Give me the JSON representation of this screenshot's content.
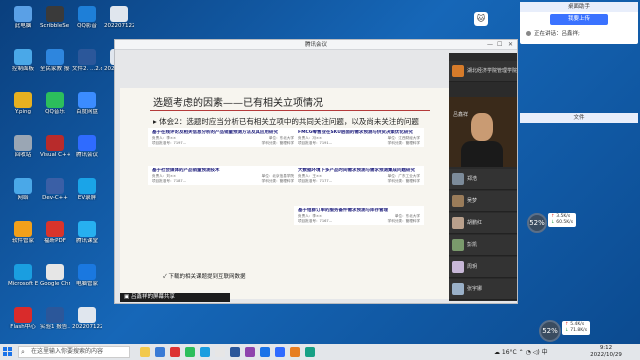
{
  "desktop": {
    "icons": [
      {
        "label": "此电脑",
        "color": "#5aa0e6"
      },
      {
        "label": "ScribbleSe\ndekl-4d...",
        "color": "#3a3a3a"
      },
      {
        "label": "QQ影音",
        "color": "#1e7fd8"
      },
      {
        "label": "2022071220001247...",
        "color": "#e0e6ee"
      },
      {
        "label": "控制面板",
        "color": "#4aa8e8"
      },
      {
        "label": "全民家教\n报名链",
        "color": "#2e86de"
      },
      {
        "label": "文件2.\n...2.docx",
        "color": "#2b579a"
      },
      {
        "label": "2022071220001247...",
        "color": "#e0e6ee"
      },
      {
        "label": "Y.ping",
        "color": "#e6b020"
      },
      {
        "label": "QQ音乐",
        "color": "#2cbe5c"
      },
      {
        "label": "百度网盘",
        "color": "#3b8cff"
      },
      {
        "label": "回收站",
        "color": "#9aa6b4"
      },
      {
        "label": "Visual C++\n6.0",
        "color": "#b82b2b"
      },
      {
        "label": "腾讯会议",
        "color": "#2f6bff"
      },
      {
        "label": "网络",
        "color": "#4aa8e8"
      },
      {
        "label": "Dev-C++",
        "color": "#3a5fa6"
      },
      {
        "label": "EV录屏",
        "color": "#1aa4e8"
      },
      {
        "label": "软件管家",
        "color": "#f2a01a"
      },
      {
        "label": "福昕PDF",
        "color": "#d9342b"
      },
      {
        "label": "腾讯课堂",
        "color": "#27b0f0"
      },
      {
        "label": "Microsoft\nEdge",
        "color": "#1a9ee0"
      },
      {
        "label": "Google\nChrome",
        "color": "#e6e6e6"
      },
      {
        "label": "电脑管家",
        "color": "#1a78e0"
      },
      {
        "label": "Flash中心",
        "color": "#d92b2b"
      },
      {
        "label": "实验1 报告...",
        "color": "#2b579a"
      },
      {
        "label": "2022071220001247...",
        "color": "#e0e6ee"
      }
    ]
  },
  "helper_panel": {
    "title": "桌面助手",
    "button_label": "我要上传",
    "speaking_text": "正在讲话：吕鑫祥;",
    "doc_title": "文件"
  },
  "meeting": {
    "window_title": "腾讯会议",
    "share_label": "吕鑫祥的屏幕共享",
    "slide": {
      "title": "选题考虑的因素——已有相关立项情况",
      "body": "体会2：选题时应当分析已有相关立项中的共同关注问题，以及尚未关注的问题（创新点）",
      "bullet": "▸",
      "note": "下载的相关课题提到互联网数据",
      "note_icon": "✓",
      "refs": [
        {
          "title": "基于在线评论及相关信息分析的产品销量预测方法及其应用研究",
          "meta": [
            "负责人：李××",
            "单位：东北大学",
            "项目批准号：7197...",
            "学科分类：管理科学"
          ]
        },
        {
          "title": "FMCG零售业在SKU层面的需求预测与供货决策优化研究",
          "meta": [
            "负责人：冯××",
            "单位：江西财经大学",
            "项目批准号：7191...",
            "学科分类：管理科学"
          ]
        },
        {
          "title": "基于社会媒体的产品销量预测技术",
          "meta": [
            "负责人：刘××",
            "单位：北京信息学院",
            "项目批准号：7187...",
            "学科分类：管理科学"
          ]
        },
        {
          "title": "大数据环境下多产品时间需求预测与需求预测集成问题研究",
          "meta": [
            "负责人：王××",
            "单位：广东工业大学",
            "项目批准号：7177...",
            "学科分类：管理科学"
          ]
        },
        {
          "title": "基于组群订单的服务备件需求预测与库存管理",
          "meta": [
            "负责人：李××",
            "单位：东北大学",
            "项目批准号：7167...",
            "学科分类：管理科学"
          ]
        }
      ]
    },
    "participants": [
      {
        "name": "湖北经济学院管理学院",
        "color": "#d67b2a"
      },
      {
        "name": "吕鑫祥",
        "color": "#6b4a2a"
      },
      {
        "name": "郑浩",
        "color": "#7c8b9a"
      },
      {
        "name": "吴梦",
        "color": "#9a7c5a"
      },
      {
        "name": "胡鹏红",
        "color": "#b9a08c"
      },
      {
        "name": "彭凯",
        "color": "#7a9a6c"
      },
      {
        "name": "周玥",
        "color": "#c8b8d8"
      },
      {
        "name": "张宇娜",
        "color": "#9ab0c8"
      }
    ]
  },
  "gauges": [
    {
      "percent": "52%",
      "up": "3.5K/s",
      "down": "60.5K/s"
    },
    {
      "percent": "52%",
      "up": "5.4K/s",
      "down": "71.8K/s"
    }
  ],
  "taskbar": {
    "search_placeholder": "在这里输入你要搜索的内容",
    "search_icon": "search-icon",
    "weather": "16°C",
    "ime": "中",
    "time": "9:12",
    "date": "2022/10/29",
    "app_colors": [
      "#f2c94c",
      "#3a7bd5",
      "#d33",
      "#2cbe5c",
      "#1a9ee0",
      "#e6e6e6",
      "#2b579a",
      "#8e44ad",
      "#1a73e8",
      "#2f6bff",
      "#e67e22",
      "#16a085"
    ]
  }
}
